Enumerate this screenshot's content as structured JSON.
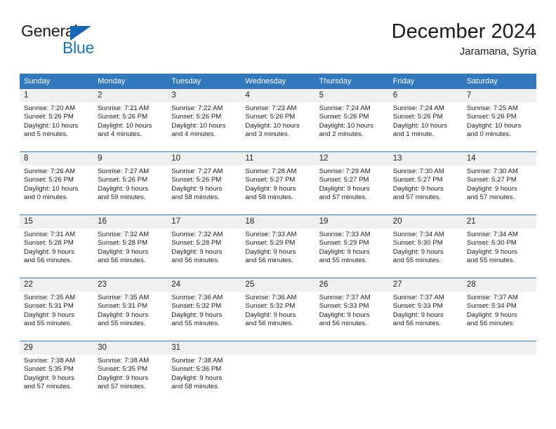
{
  "logo": {
    "primary_text": "General",
    "secondary_text": "Blue",
    "triangle_icon": "triangle-icon",
    "primary_color": "#1b1b1b",
    "secondary_color": "#1775bd"
  },
  "header": {
    "title": "December 2024",
    "subtitle": "Jaramana, Syria"
  },
  "theme": {
    "header_row_bg": "#3178be",
    "day_band_bg": "#f0f0f0",
    "row_separator": "#3178be",
    "text": "#1b1b1b"
  },
  "weekdays": [
    "Sunday",
    "Monday",
    "Tuesday",
    "Wednesday",
    "Thursday",
    "Friday",
    "Saturday"
  ],
  "weeks": [
    [
      {
        "day": "1",
        "sunrise": "Sunrise: 7:20 AM",
        "sunset": "Sunset: 5:26 PM",
        "daylight1": "Daylight: 10 hours",
        "daylight2": "and 5 minutes."
      },
      {
        "day": "2",
        "sunrise": "Sunrise: 7:21 AM",
        "sunset": "Sunset: 5:26 PM",
        "daylight1": "Daylight: 10 hours",
        "daylight2": "and 4 minutes."
      },
      {
        "day": "3",
        "sunrise": "Sunrise: 7:22 AM",
        "sunset": "Sunset: 5:26 PM",
        "daylight1": "Daylight: 10 hours",
        "daylight2": "and 4 minutes."
      },
      {
        "day": "4",
        "sunrise": "Sunrise: 7:23 AM",
        "sunset": "Sunset: 5:26 PM",
        "daylight1": "Daylight: 10 hours",
        "daylight2": "and 3 minutes."
      },
      {
        "day": "5",
        "sunrise": "Sunrise: 7:24 AM",
        "sunset": "Sunset: 5:26 PM",
        "daylight1": "Daylight: 10 hours",
        "daylight2": "and 2 minutes."
      },
      {
        "day": "6",
        "sunrise": "Sunrise: 7:24 AM",
        "sunset": "Sunset: 5:26 PM",
        "daylight1": "Daylight: 10 hours",
        "daylight2": "and 1 minute."
      },
      {
        "day": "7",
        "sunrise": "Sunrise: 7:25 AM",
        "sunset": "Sunset: 5:26 PM",
        "daylight1": "Daylight: 10 hours",
        "daylight2": "and 0 minutes."
      }
    ],
    [
      {
        "day": "8",
        "sunrise": "Sunrise: 7:26 AM",
        "sunset": "Sunset: 5:26 PM",
        "daylight1": "Daylight: 10 hours",
        "daylight2": "and 0 minutes."
      },
      {
        "day": "9",
        "sunrise": "Sunrise: 7:27 AM",
        "sunset": "Sunset: 5:26 PM",
        "daylight1": "Daylight: 9 hours",
        "daylight2": "and 59 minutes."
      },
      {
        "day": "10",
        "sunrise": "Sunrise: 7:27 AM",
        "sunset": "Sunset: 5:26 PM",
        "daylight1": "Daylight: 9 hours",
        "daylight2": "and 58 minutes."
      },
      {
        "day": "11",
        "sunrise": "Sunrise: 7:28 AM",
        "sunset": "Sunset: 5:27 PM",
        "daylight1": "Daylight: 9 hours",
        "daylight2": "and 58 minutes."
      },
      {
        "day": "12",
        "sunrise": "Sunrise: 7:29 AM",
        "sunset": "Sunset: 5:27 PM",
        "daylight1": "Daylight: 9 hours",
        "daylight2": "and 57 minutes."
      },
      {
        "day": "13",
        "sunrise": "Sunrise: 7:30 AM",
        "sunset": "Sunset: 5:27 PM",
        "daylight1": "Daylight: 9 hours",
        "daylight2": "and 57 minutes."
      },
      {
        "day": "14",
        "sunrise": "Sunrise: 7:30 AM",
        "sunset": "Sunset: 5:27 PM",
        "daylight1": "Daylight: 9 hours",
        "daylight2": "and 57 minutes."
      }
    ],
    [
      {
        "day": "15",
        "sunrise": "Sunrise: 7:31 AM",
        "sunset": "Sunset: 5:28 PM",
        "daylight1": "Daylight: 9 hours",
        "daylight2": "and 56 minutes."
      },
      {
        "day": "16",
        "sunrise": "Sunrise: 7:32 AM",
        "sunset": "Sunset: 5:28 PM",
        "daylight1": "Daylight: 9 hours",
        "daylight2": "and 56 minutes."
      },
      {
        "day": "17",
        "sunrise": "Sunrise: 7:32 AM",
        "sunset": "Sunset: 5:28 PM",
        "daylight1": "Daylight: 9 hours",
        "daylight2": "and 56 minutes."
      },
      {
        "day": "18",
        "sunrise": "Sunrise: 7:33 AM",
        "sunset": "Sunset: 5:29 PM",
        "daylight1": "Daylight: 9 hours",
        "daylight2": "and 56 minutes."
      },
      {
        "day": "19",
        "sunrise": "Sunrise: 7:33 AM",
        "sunset": "Sunset: 5:29 PM",
        "daylight1": "Daylight: 9 hours",
        "daylight2": "and 55 minutes."
      },
      {
        "day": "20",
        "sunrise": "Sunrise: 7:34 AM",
        "sunset": "Sunset: 5:30 PM",
        "daylight1": "Daylight: 9 hours",
        "daylight2": "and 55 minutes."
      },
      {
        "day": "21",
        "sunrise": "Sunrise: 7:34 AM",
        "sunset": "Sunset: 5:30 PM",
        "daylight1": "Daylight: 9 hours",
        "daylight2": "and 55 minutes."
      }
    ],
    [
      {
        "day": "22",
        "sunrise": "Sunrise: 7:35 AM",
        "sunset": "Sunset: 5:31 PM",
        "daylight1": "Daylight: 9 hours",
        "daylight2": "and 55 minutes."
      },
      {
        "day": "23",
        "sunrise": "Sunrise: 7:35 AM",
        "sunset": "Sunset: 5:31 PM",
        "daylight1": "Daylight: 9 hours",
        "daylight2": "and 55 minutes."
      },
      {
        "day": "24",
        "sunrise": "Sunrise: 7:36 AM",
        "sunset": "Sunset: 5:32 PM",
        "daylight1": "Daylight: 9 hours",
        "daylight2": "and 55 minutes."
      },
      {
        "day": "25",
        "sunrise": "Sunrise: 7:36 AM",
        "sunset": "Sunset: 5:32 PM",
        "daylight1": "Daylight: 9 hours",
        "daylight2": "and 56 minutes."
      },
      {
        "day": "26",
        "sunrise": "Sunrise: 7:37 AM",
        "sunset": "Sunset: 5:33 PM",
        "daylight1": "Daylight: 9 hours",
        "daylight2": "and 56 minutes."
      },
      {
        "day": "27",
        "sunrise": "Sunrise: 7:37 AM",
        "sunset": "Sunset: 5:33 PM",
        "daylight1": "Daylight: 9 hours",
        "daylight2": "and 56 minutes."
      },
      {
        "day": "28",
        "sunrise": "Sunrise: 7:37 AM",
        "sunset": "Sunset: 5:34 PM",
        "daylight1": "Daylight: 9 hours",
        "daylight2": "and 56 minutes."
      }
    ],
    [
      {
        "day": "29",
        "sunrise": "Sunrise: 7:38 AM",
        "sunset": "Sunset: 5:35 PM",
        "daylight1": "Daylight: 9 hours",
        "daylight2": "and 57 minutes."
      },
      {
        "day": "30",
        "sunrise": "Sunrise: 7:38 AM",
        "sunset": "Sunset: 5:35 PM",
        "daylight1": "Daylight: 9 hours",
        "daylight2": "and 57 minutes."
      },
      {
        "day": "31",
        "sunrise": "Sunrise: 7:38 AM",
        "sunset": "Sunset: 5:36 PM",
        "daylight1": "Daylight: 9 hours",
        "daylight2": "and 58 minutes."
      },
      {
        "day": "",
        "sunrise": "",
        "sunset": "",
        "daylight1": "",
        "daylight2": ""
      },
      {
        "day": "",
        "sunrise": "",
        "sunset": "",
        "daylight1": "",
        "daylight2": ""
      },
      {
        "day": "",
        "sunrise": "",
        "sunset": "",
        "daylight1": "",
        "daylight2": ""
      },
      {
        "day": "",
        "sunrise": "",
        "sunset": "",
        "daylight1": "",
        "daylight2": ""
      }
    ]
  ]
}
